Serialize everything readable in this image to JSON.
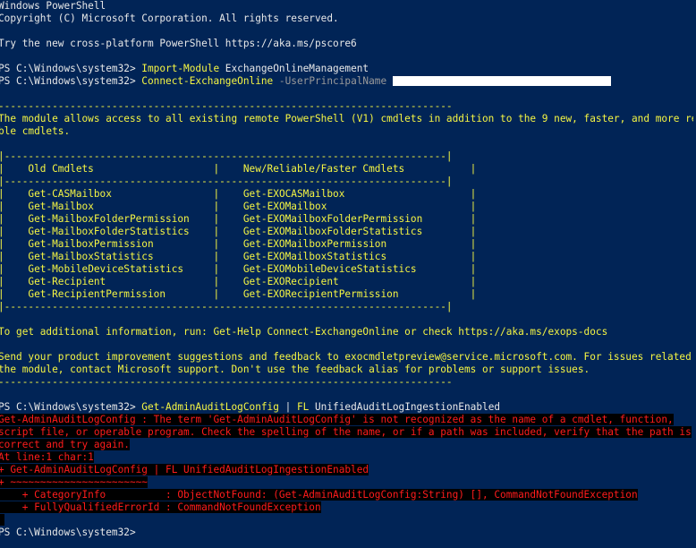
{
  "console": {
    "header": {
      "title": "Windows PowerShell",
      "copyright": "Copyright (C) Microsoft Corporation. All rights reserved.",
      "tip": "Try the new cross-platform PowerShell https://aka.ms/pscore6"
    },
    "prompt": "PS C:\\Windows\\system32> ",
    "cmd1": {
      "name": "Import-Module",
      "arg": " ExchangeOnlineManagement"
    },
    "cmd2": {
      "name": "Connect-ExchangeOnline",
      "param": " -UserPrincipalName "
    },
    "banner": {
      "rule": "----------------------------------------------------------------------------",
      "line1": "The module allows access to all existing remote PowerShell (V1) cmdlets in addition to the 9 new, faster, and more relia",
      "line2": "ble cmdlets.",
      "table_border": "|--------------------------------------------------------------------------|",
      "header_row": "|    Old Cmdlets                    |    New/Reliable/Faster Cmdlets           |",
      "rows": [
        {
          "old": "Get-CASMailbox",
          "new": "Get-EXOCASMailbox"
        },
        {
          "old": "Get-Mailbox",
          "new": "Get-EXOMailbox"
        },
        {
          "old": "Get-MailboxFolderPermission",
          "new": "Get-EXOMailboxFolderPermission"
        },
        {
          "old": "Get-MailboxFolderStatistics",
          "new": "Get-EXOMailboxFolderStatistics"
        },
        {
          "old": "Get-MailboxPermission",
          "new": "Get-EXOMailboxPermission"
        },
        {
          "old": "Get-MailboxStatistics",
          "new": "Get-EXOMailboxStatistics"
        },
        {
          "old": "Get-MobileDeviceStatistics",
          "new": "Get-EXOMobileDeviceStatistics"
        },
        {
          "old": "Get-Recipient",
          "new": "Get-EXORecipient"
        },
        {
          "old": "Get-RecipientPermission",
          "new": "Get-EXORecipientPermission"
        }
      ],
      "help": "To get additional information, run: Get-Help Connect-ExchangeOnline or check https://aka.ms/exops-docs",
      "feedback1": "Send your product improvement suggestions and feedback to exocmdletpreview@service.microsoft.com. For issues related to",
      "feedback2": "the module, contact Microsoft support. Don't use the feedback alias for problems or support issues.",
      "rule2": "----------------------------------------------------------------------------"
    },
    "cmd3": {
      "name": "Get-AdminAuditLogConfig",
      "pipe": " | ",
      "name2": "FL",
      "arg": " UnifiedAuditLogIngestionEnabled"
    },
    "error": {
      "l1": "Get-AdminAuditLogConfig : The term 'Get-AdminAuditLogConfig' is not recognized as the name of a cmdlet, function,",
      "l2": "script file, or operable program. Check the spelling of the name, or if a path was included, verify that the path is",
      "l3": "correct and try again.",
      "l4": "At line:1 char:1",
      "l5": "+ Get-AdminAuditLogConfig | FL UnifiedAuditLogIngestionEnabled",
      "l6": "+ ~~~~~~~~~~~~~~~~~~~~~~~",
      "l7": "    + CategoryInfo          : ObjectNotFound: (Get-AdminAuditLogConfig:String) [], CommandNotFoundException",
      "l8": "    + FullyQualifiedErrorId : CommandNotFoundException"
    },
    "final_prompt": "PS C:\\Windows\\system32> ",
    "colors": {
      "background": "#012456",
      "text": "#e8e8e8",
      "cmdlet": "#f5f543",
      "param": "#9a9a9a",
      "error": "#ff1c1c",
      "error_bg": "#000000"
    }
  }
}
